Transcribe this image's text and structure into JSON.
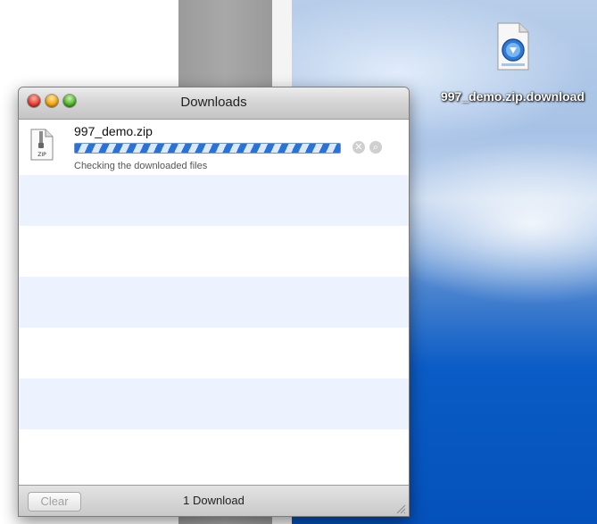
{
  "window": {
    "title": "Downloads"
  },
  "downloads": [
    {
      "file_name": "997_demo.zip",
      "file_type_label": "ZIP",
      "status": "Checking the downloaded files",
      "progress": "indeterminate"
    }
  ],
  "footer": {
    "clear_label": "Clear",
    "count_label": "1 Download"
  },
  "desktop": {
    "icon_label": "997_demo.zip.download"
  },
  "colors": {
    "progress_blue": "#2b72d6",
    "row_stripe": "#edf3fe",
    "desktop_blue": "#0451bb"
  },
  "icons": [
    "close-light-icon",
    "minimize-light-icon",
    "zoom-light-icon",
    "zip-file-icon",
    "stop-icon",
    "magnifier-icon",
    "resize-grip-icon",
    "download-file-icon"
  ]
}
